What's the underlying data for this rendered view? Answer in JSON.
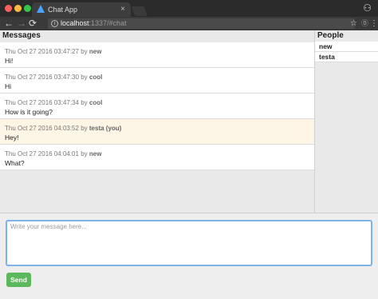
{
  "browser": {
    "tab_title": "Chat App",
    "tab_close": "×",
    "url_host": "localhost",
    "url_rest": ":1337/#chat",
    "nav": {
      "back": "←",
      "forward": "→",
      "reload": "⟳"
    },
    "star": "☆",
    "info": "i",
    "ext": "⓪",
    "menu": "⋮",
    "profile": "⚇"
  },
  "messages": {
    "header": "Messages",
    "items": [
      {
        "timestamp": "Thu Oct 27 2016 03:47:27",
        "by": "by",
        "author": "new",
        "text": "Hi!"
      },
      {
        "timestamp": "Thu Oct 27 2016 03:47:30",
        "by": "by",
        "author": "cool",
        "text": "Hi"
      },
      {
        "timestamp": "Thu Oct 27 2016 03:47:34",
        "by": "by",
        "author": "cool",
        "text": "How is it going?"
      },
      {
        "timestamp": "Thu Oct 27 2016 04:03:52",
        "by": "by",
        "author": "testa (you)",
        "text": "Hey!"
      },
      {
        "timestamp": "Thu Oct 27 2016 04:04:01",
        "by": "by",
        "author": "new",
        "text": "What?"
      }
    ]
  },
  "people": {
    "header": "People",
    "items": [
      "new",
      "testa"
    ]
  },
  "composer": {
    "placeholder": "Write your message here...",
    "send_label": "Send"
  },
  "colors": {
    "send_button": "#5cb85c",
    "own_message_bg": "#fdf6e6",
    "input_focus_border": "#7fb2e6"
  }
}
